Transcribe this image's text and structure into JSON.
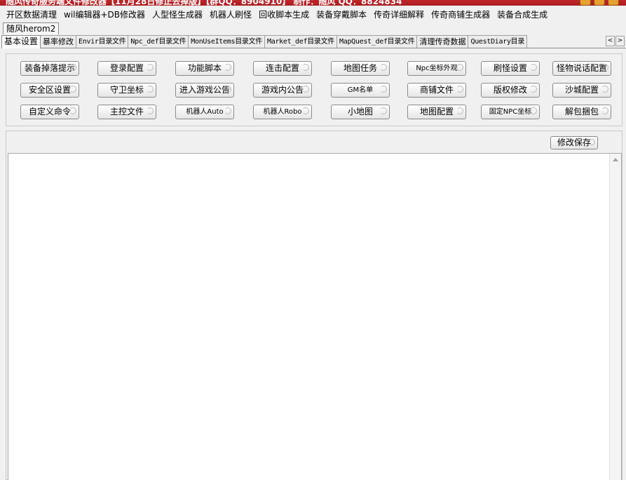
{
  "window": {
    "title": "随风传奇服务端文件修改器【11月28日修正去掉版】【群QQ：8904910】 制作：随风 QQ：8824834"
  },
  "menu": [
    "开区数据清理",
    "wil编辑器+DB修改器",
    "人型怪生成器",
    "机器人刷怪",
    "回收脚本生成",
    "装备穿戴脚本",
    "传奇详细解释",
    "传奇商铺生成器",
    "装备合成生成"
  ],
  "profile_tab": "随风herom2",
  "tabs": [
    "基本设置",
    "暴率修改",
    "Envir目录文件",
    "Npc_def目录文件",
    "MonUseItems目录文件",
    "Market_def目录文件",
    "MapQuest_def目录文件",
    "清理传奇数据",
    "QuestDiary目录"
  ],
  "tab_arrows": {
    "left": "<",
    "right": ">"
  },
  "buttons": [
    [
      "装备掉落提示",
      "登录配置",
      "功能脚本",
      "连击配置",
      "地图任务",
      "Npc坐标外观",
      "刷怪设置",
      "怪物说话配置"
    ],
    [
      "安全区设置",
      "守卫坐标",
      "进入游戏公告",
      "游戏内公告",
      "GM名单",
      "商铺文件",
      "版权修改",
      "沙城配置"
    ],
    [
      "自定义命令",
      "主控文件",
      "机器人Auto",
      "机器人Robo",
      "小地图",
      "地图配置",
      "固定NPC坐标",
      "解包捆包"
    ]
  ],
  "editor": {
    "save_label": "修改保存",
    "content": ""
  }
}
